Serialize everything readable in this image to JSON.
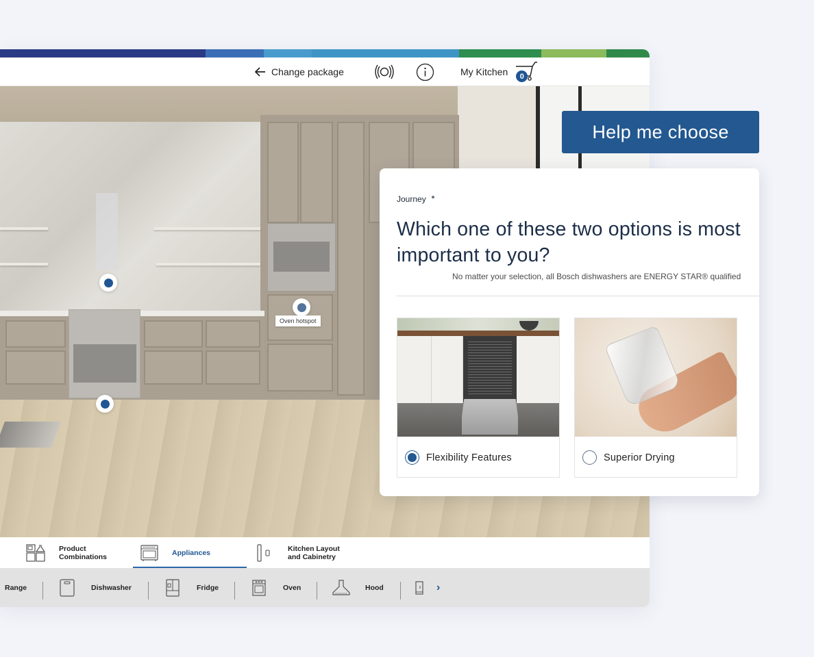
{
  "brand": {
    "stripe_colors": [
      "#2b3a84",
      "#25307a",
      "#3a6fb5",
      "#4a9bcd",
      "#3f94c6",
      "#2e8d4f",
      "#8bbb5a",
      "#2f8a4a"
    ]
  },
  "topnav": {
    "change_package_label": "Change package",
    "ar_icon": "ar-view-icon",
    "info_icon": "info-icon",
    "my_kitchen_label": "My Kitchen",
    "cart_count": "0"
  },
  "scene": {
    "hotspot_tooltip": "Oven hotspot",
    "hotspots": [
      "hood-hotspot",
      "range-hotspot",
      "oven-hotspot"
    ]
  },
  "category_tabs": [
    {
      "label_line1": "Product",
      "label_line2": "Combinations",
      "icon": "product-combinations-icon",
      "active": false
    },
    {
      "label_line1": "Appliances",
      "label_line2": "",
      "icon": "appliances-icon",
      "active": true
    },
    {
      "label_line1": "Kitchen Layout",
      "label_line2": "and Cabinetry",
      "icon": "kitchen-layout-icon",
      "active": false
    }
  ],
  "appliances": [
    {
      "label": "Range",
      "icon": "range-icon"
    },
    {
      "label": "Dishwasher",
      "icon": "dishwasher-icon"
    },
    {
      "label": "Fridge",
      "icon": "fridge-icon"
    },
    {
      "label": "Oven",
      "icon": "oven-icon"
    },
    {
      "label": "Hood",
      "icon": "hood-icon"
    },
    {
      "label": "",
      "icon": "appliance-more-icon"
    }
  ],
  "help_button_label": "Help me choose",
  "journey": {
    "label": "Journey",
    "question": "Which one of these two options is most important to you?",
    "subtext": "No matter your selection, all Bosch dishwashers are ENERGY STAR® qualified",
    "options": [
      {
        "label": "Flexibility Features",
        "selected": true
      },
      {
        "label": "Superior Drying",
        "selected": false
      }
    ]
  },
  "colors": {
    "accent": "#235890",
    "page_bg": "#f2f4f9"
  }
}
